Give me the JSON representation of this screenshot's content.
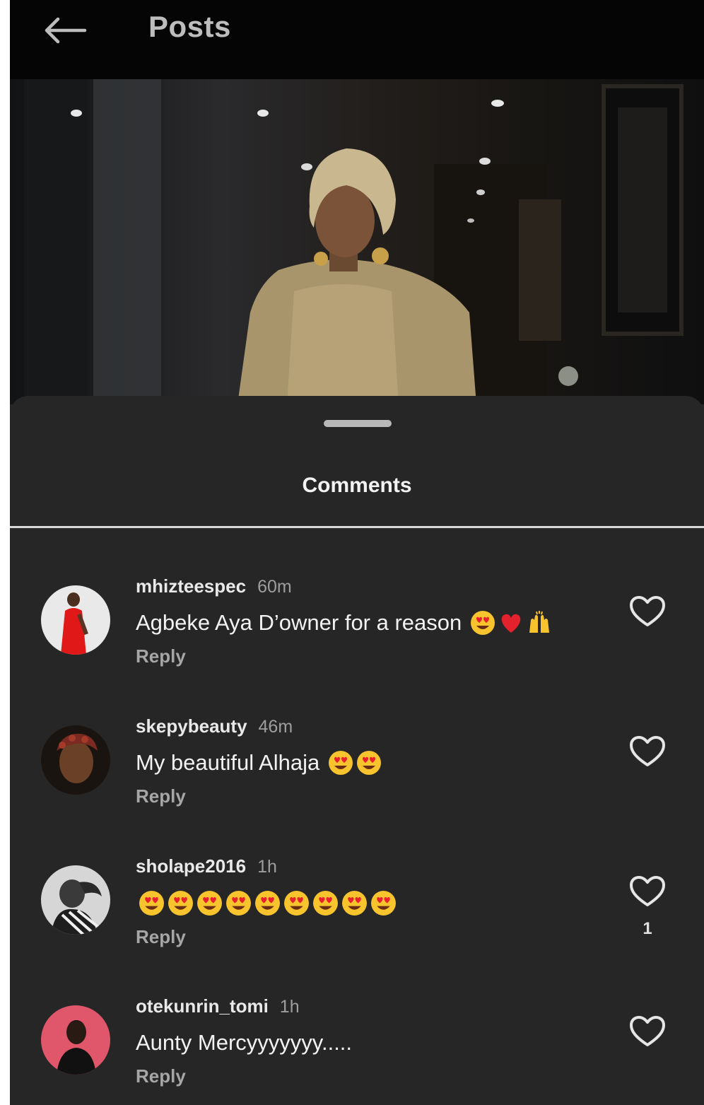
{
  "header": {
    "title": "Posts",
    "back_icon": "arrow-left-icon"
  },
  "post": {
    "image_icon": "photo"
  },
  "sheet": {
    "title": "Comments"
  },
  "comments": [
    {
      "username": "mhizteespec",
      "time": "60m",
      "text": "Agbeke Aya D’owner for a reason",
      "emojis": [
        "heart-eyes-emoji",
        "red-heart-emoji",
        "raised-hands-emoji"
      ],
      "reply_label": "Reply",
      "likes": ""
    },
    {
      "username": "skepybeauty",
      "time": "46m",
      "text": "My beautiful Alhaja",
      "emojis": [
        "heart-eyes-emoji",
        "heart-eyes-emoji"
      ],
      "reply_label": "Reply",
      "likes": ""
    },
    {
      "username": "sholape2016",
      "time": "1h",
      "text": "",
      "emojis": [
        "heart-eyes-emoji",
        "heart-eyes-emoji",
        "heart-eyes-emoji",
        "heart-eyes-emoji",
        "heart-eyes-emoji",
        "heart-eyes-emoji",
        "heart-eyes-emoji",
        "heart-eyes-emoji",
        "heart-eyes-emoji"
      ],
      "reply_label": "Reply",
      "likes": "1"
    },
    {
      "username": "otekunrin_tomi",
      "time": "1h",
      "text": "Aunty Mercyyyyyyy.....",
      "emojis": [],
      "reply_label": "Reply",
      "likes": ""
    }
  ],
  "colors": {
    "background": "#262626",
    "topbar": "#050505",
    "text_primary": "#f2f2f2",
    "text_secondary": "#9e9e9e"
  }
}
